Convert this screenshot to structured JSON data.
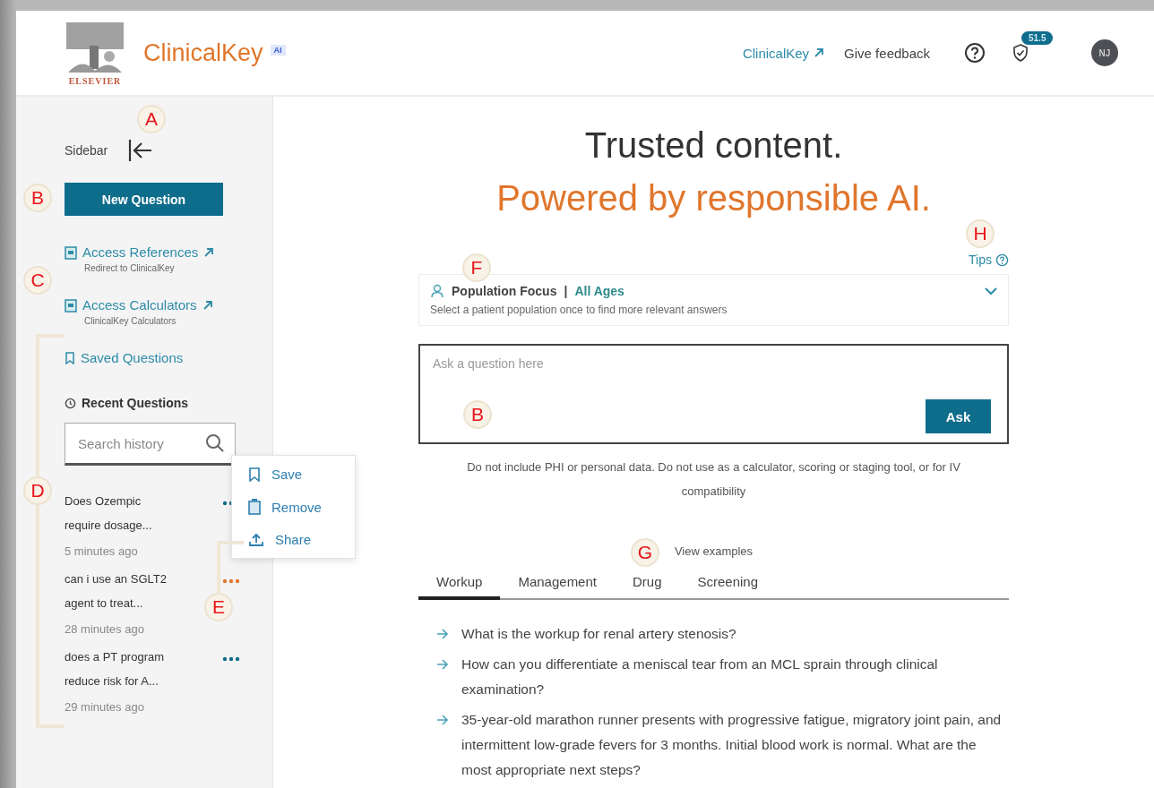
{
  "header": {
    "brand": "ClinicalKey",
    "brand_badge": "AI",
    "publisher": "ELSEVIER",
    "links": [
      {
        "label": "ClinicalKey",
        "kind": "external"
      },
      {
        "label": "Give feedback",
        "kind": "plain"
      }
    ],
    "badge_count": "51.5",
    "avatar": "NJ"
  },
  "sidebar": {
    "title": "Sidebar",
    "new_button": "New Question",
    "links": [
      {
        "label": "Access References",
        "subtitle": "Redirect to ClinicalKey",
        "kind": "external"
      },
      {
        "label": "Access Calculators",
        "subtitle": "ClinicalKey Calculators",
        "kind": "external"
      },
      {
        "label": "Saved Questions",
        "kind": "saved"
      }
    ],
    "recent_title": "Recent Questions",
    "search": {
      "placeholder": "Search history"
    },
    "history": [
      {
        "lines": [
          "Does Ozempic",
          "require dosage..."
        ],
        "time": "5 minutes ago",
        "active": false
      },
      {
        "lines": [
          "can i use an SGLT2",
          "agent to treat..."
        ],
        "time": "28 minutes ago",
        "active": true
      },
      {
        "lines": [
          "does a PT program",
          "reduce risk for A..."
        ],
        "time": "29 minutes ago",
        "active": false
      }
    ],
    "menu": [
      {
        "label": "Save",
        "kind": "save"
      },
      {
        "label": "Remove",
        "kind": "remove"
      },
      {
        "label": "Share",
        "kind": "share"
      }
    ]
  },
  "main": {
    "headline": "Trusted content.",
    "subheadline": "Powered by responsible AI.",
    "tips": "Tips",
    "population": {
      "label": "Population Focus",
      "separator": "|",
      "value": "All Ages",
      "hint": "Select a patient population once to find more relevant answers"
    },
    "question": {
      "placeholder": "Ask a question here"
    },
    "ask_button": "Ask",
    "disclaimer": "Do not include PHI or personal data. Do not use as a calculator, scoring or staging tool, or for IV compatibility",
    "examples_title": "View examples",
    "tabs": [
      {
        "label": "Workup",
        "selected": true
      },
      {
        "label": "Management",
        "selected": false
      },
      {
        "label": "Drug",
        "selected": false
      },
      {
        "label": "Screening",
        "selected": false
      }
    ],
    "examples": [
      "What is the workup for renal artery stenosis?",
      "How can you differentiate a meniscal tear from an MCL sprain through clinical examination?",
      "35-year-old marathon runner presents with progressive fatigue, migratory joint pain, and intermittent low-grade fevers for 3 months. Initial blood work is normal. What are the most appropriate next steps?"
    ]
  },
  "callouts": [
    "A",
    "B",
    "C",
    "D",
    "E",
    "F",
    "G",
    "H",
    "B"
  ]
}
